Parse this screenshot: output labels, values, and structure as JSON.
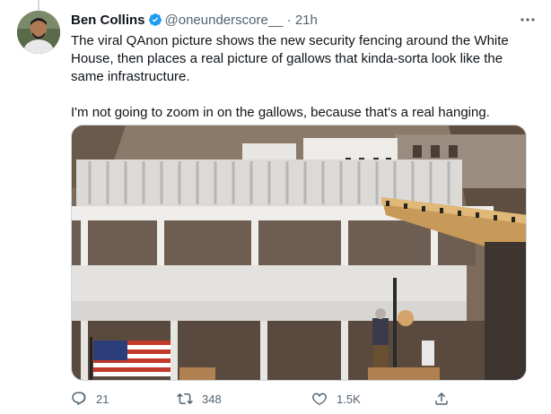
{
  "tweet": {
    "author_name": "Ben Collins",
    "handle": "@oneunderscore__",
    "separator": "·",
    "timestamp": "21h",
    "paragraphs": [
      "The viral QAnon picture shows the new security fencing around the White House, then places a real picture of gallows that kinda-sorta look like the same infrastructure.",
      "I'm not going to zoom in on the gallows, because that's a real hanging."
    ]
  },
  "actions": {
    "reply_count": "21",
    "retweet_count": "348",
    "like_count": "1.5K"
  },
  "icons": {
    "verified": "verified-badge-icon",
    "more": "more-options-icon",
    "reply": "reply-icon",
    "retweet": "retweet-icon",
    "like": "like-icon",
    "share": "share-icon"
  },
  "colors": {
    "verified_blue": "#1d9bf0",
    "secondary_text": "#536471",
    "primary_text": "#0f1419",
    "border": "#cfd9de"
  }
}
